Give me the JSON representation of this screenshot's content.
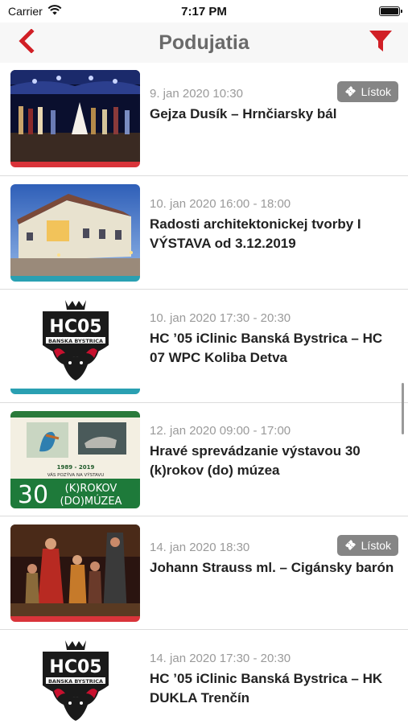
{
  "status_bar": {
    "carrier": "Carrier",
    "time": "7:17 PM"
  },
  "header": {
    "title": "Podujatia"
  },
  "colors": {
    "brand_red": "#d11f26",
    "event_bar_red": "#d9343a",
    "event_bar_teal": "#2aa0b2",
    "badge_grey": "#858585"
  },
  "ticket_label": "Lístok",
  "events": [
    {
      "date": "9. jan 2020 10:30",
      "title": "Gejza Dusík – Hrnčiarsky bál",
      "has_ticket": true,
      "image": "theater-stage-photo",
      "bar_color": "#d9343a"
    },
    {
      "date": "10. jan 2020 16:00 - 18:00",
      "title": "Radosti architektonickej tvorby I VÝSTAVA od 3.12.2019",
      "has_ticket": false,
      "image": "historic-building-photo",
      "bar_color": "#2aa0b2"
    },
    {
      "date": "10. jan 2020 17:30 - 20:30",
      "title": "HC ’05 iClinic Banská Bystrica – HC 07 WPC Koliba Detva",
      "has_ticket": false,
      "image": "hc05-logo",
      "logo_text": "HC05",
      "logo_subtext": "BANSKA BYSTRICA",
      "bar_color": "#2aa0b2"
    },
    {
      "date": "12. jan 2020 09:00 - 17:00",
      "title": "Hravé sprevádzanie výstavou 30 (k)rokov (do) múzea",
      "has_ticket": false,
      "image": "museum-poster",
      "poster_years": "1989 - 2019",
      "poster_invite": "VÁS POZÝVA NA VÝSTAVU",
      "poster_number": "30",
      "poster_line1": "(K)ROKOV",
      "poster_line2": "(DO)MÚZEA",
      "bar_color": "#ffffff"
    },
    {
      "date": "14. jan 2020 18:30",
      "title": "Johann Strauss ml. – Cigánsky barón",
      "has_ticket": true,
      "image": "opera-stage-photo",
      "bar_color": "#d9343a"
    },
    {
      "date": "14. jan 2020 17:30 - 20:30",
      "title": "HC ’05 iClinic Banská Bystrica – HK DUKLA Trenčín",
      "has_ticket": false,
      "image": "hc05-logo",
      "logo_text": "HC05",
      "logo_subtext": "BANSKA BYSTRICA",
      "bar_color": "#2aa0b2"
    }
  ]
}
